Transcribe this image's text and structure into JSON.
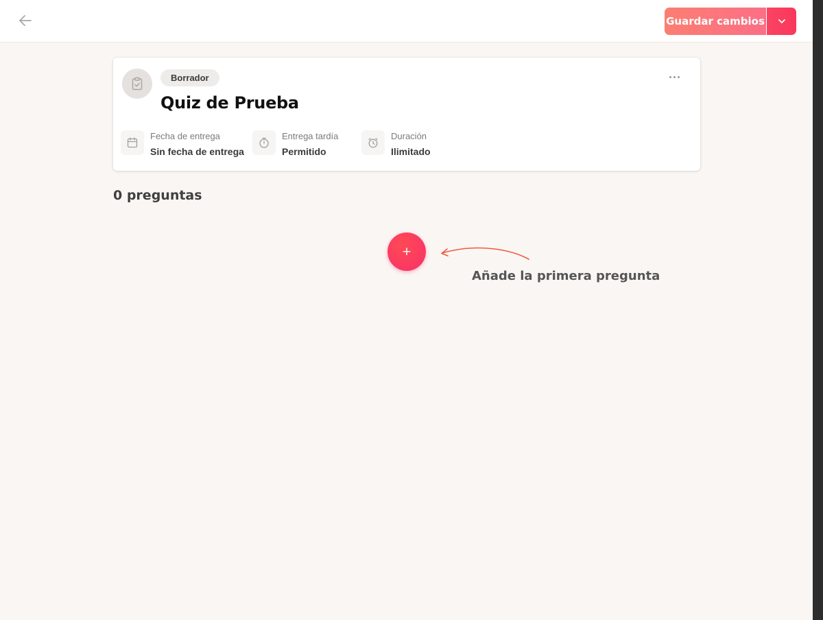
{
  "header": {
    "back_icon": "arrow-left-icon",
    "save_label": "Guardar cambios",
    "save_dropdown_icon": "chevron-down-icon",
    "accent_start": "#fb7e73",
    "accent_end": "#f9375c"
  },
  "quiz": {
    "icon": "clipboard-check-icon",
    "status": "Borrador",
    "title": "Quiz de Prueba",
    "more_icon": "more-horizontal-icon",
    "meta": [
      {
        "icon": "calendar-icon",
        "label": "Fecha de entrega",
        "value": "Sin fecha de entrega"
      },
      {
        "icon": "stopwatch-icon",
        "label": "Entrega tardía",
        "value": "Permitido"
      },
      {
        "icon": "alarm-clock-icon",
        "label": "Duración",
        "value": "Ilimitado"
      }
    ]
  },
  "questions": {
    "count_label": "0 preguntas",
    "add_label": "+",
    "hint": "Añade la primera pregunta"
  }
}
